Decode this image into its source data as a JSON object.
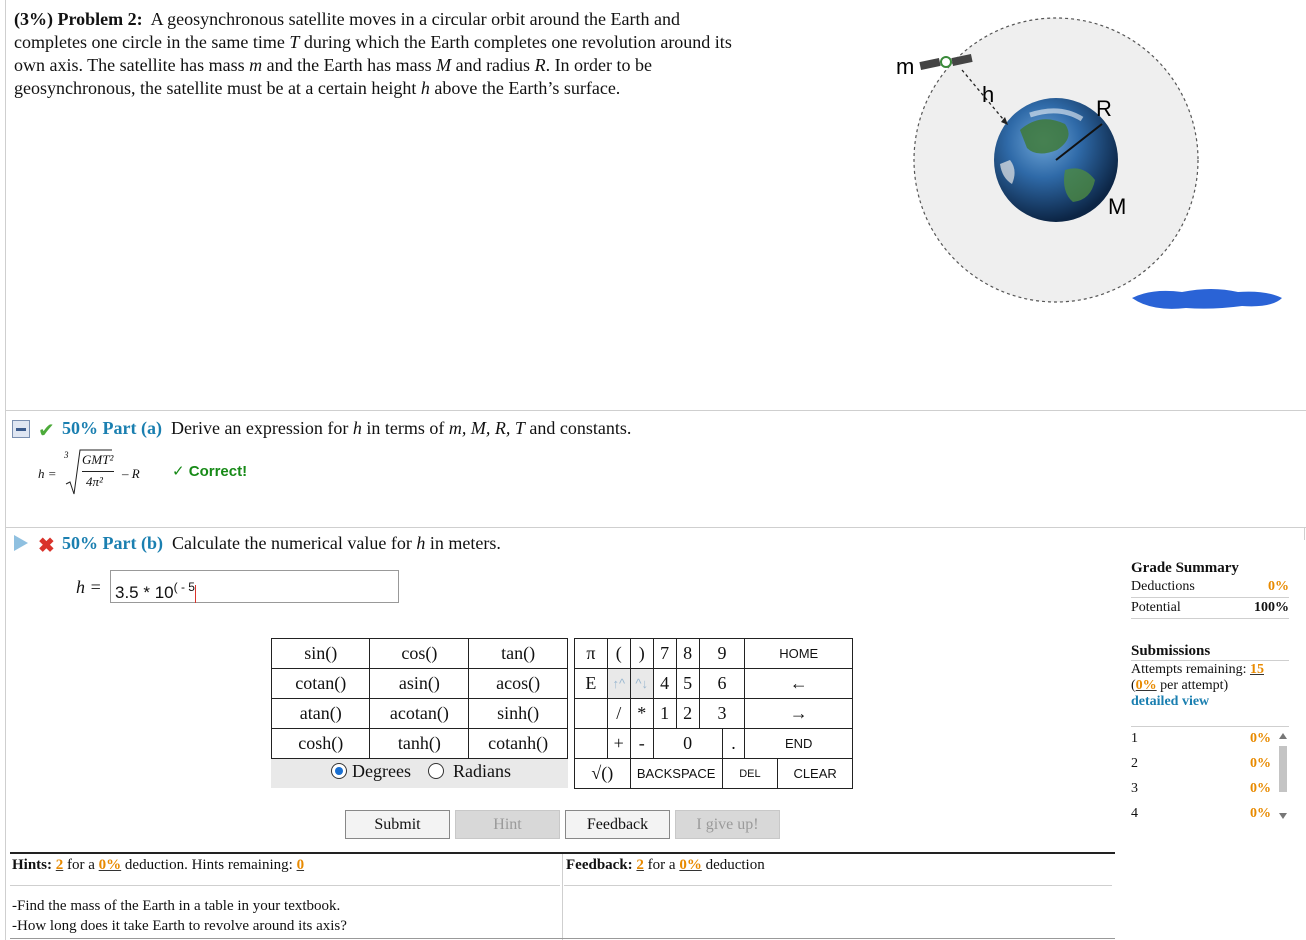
{
  "problem": {
    "percent": "(3%)",
    "label": "Problem 2:",
    "text_l1": "A geosynchronous satellite moves in a circular orbit around the Earth and",
    "text_l2a": "completes one circle in the same time ",
    "T": "T",
    "text_l2b": " during which the Earth completes one revolution around its",
    "text_l3a": "own axis. The satellite has mass ",
    "m": "m",
    "text_l3b": " and the Earth has mass ",
    "M": "M",
    "text_l3c": " and radius ",
    "R": "R",
    "text_l3d": ". In order to be",
    "text_l4a": "geosynchronous, the satellite must be at a certain height ",
    "h": "h",
    "text_l4b": " above the Earth’s surface."
  },
  "figure": {
    "m_label": "m",
    "h_label": "h",
    "R_label": "R",
    "M_label": "M"
  },
  "part_a": {
    "tag": "50% Part (a)",
    "text_a": "Derive an expression for ",
    "h": "h",
    "text_b": " in terms of ",
    "vars": "m, M, R, T",
    "text_c": " and constants.",
    "formula_lhs": "h =",
    "formula_index": "3",
    "formula_num": "GMT²",
    "formula_den": "4π²",
    "formula_tail": "– R",
    "status": "✓ Correct!"
  },
  "part_b": {
    "tag": "50% Part (b)",
    "text_a": "Calculate the numerical value for ",
    "h": "h",
    "text_b": " in meters.",
    "answer_label": "h =",
    "answer_base": "3.5 * 10",
    "answer_exp": "( - 5"
  },
  "keypad": {
    "functions": [
      [
        "sin()",
        "cos()",
        "tan()"
      ],
      [
        "cotan()",
        "asin()",
        "acos()"
      ],
      [
        "atan()",
        "acotan()",
        "sinh()"
      ],
      [
        "cosh()",
        "tanh()",
        "cotanh()"
      ]
    ],
    "degrees": "Degrees",
    "radians": "Radians",
    "angle_mode": "Degrees",
    "pi": "π",
    "open": "(",
    "close": ")",
    "e": "E",
    "up": "↑^",
    "down": "^↓",
    "slash": "/",
    "star": "*",
    "plus": "+",
    "minus": "-",
    "sqrt": "√()",
    "backspace": "BACKSPACE",
    "del": "DEL",
    "clear": "CLEAR",
    "home": "HOME",
    "left": "←",
    "right": "→",
    "end": "END",
    "d7": "7",
    "d8": "8",
    "d9": "9",
    "d4": "4",
    "d5": "5",
    "d6": "6",
    "d1": "1",
    "d2": "2",
    "d3": "3",
    "d0": "0",
    "dot": "."
  },
  "buttons": {
    "submit": "Submit",
    "hint": "Hint",
    "feedback": "Feedback",
    "giveup": "I give up!"
  },
  "hints": {
    "label": "Hints:",
    "count": "2",
    "for_a": "for a",
    "pct": "0%",
    "deduction": "deduction. Hints remaining:",
    "remaining": "0",
    "line1": "-Find the mass of the Earth in a table in your textbook.",
    "line2": "-How long does it take Earth to revolve around its axis?"
  },
  "feedback": {
    "label": "Feedback:",
    "count": "2",
    "for_a": "for a",
    "pct": "0%",
    "deduction": "deduction"
  },
  "grade": {
    "title": "Grade Summary",
    "deductions_label": "Deductions",
    "deductions_value": "0%",
    "potential_label": "Potential",
    "potential_value": "100%",
    "submissions_title": "Submissions",
    "attempts_label": "Attempts remaining:",
    "attempts_value": "15",
    "per_attempt_pct": "0%",
    "per_attempt_text": "per attempt)",
    "detailed": "detailed view",
    "rows": [
      {
        "n": "1",
        "v": "0%"
      },
      {
        "n": "2",
        "v": "0%"
      },
      {
        "n": "3",
        "v": "0%"
      },
      {
        "n": "4",
        "v": "0%"
      }
    ]
  },
  "colors": {
    "accent_blue": "#1a7fb0",
    "correct_green": "#178a17",
    "orange": "#e88a00",
    "error_red": "#d9332b"
  }
}
